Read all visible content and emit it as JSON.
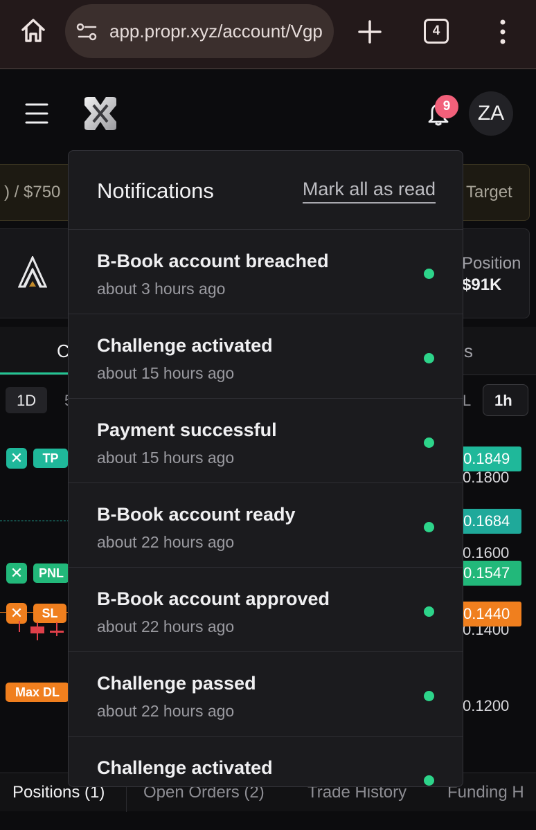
{
  "browser": {
    "url": "app.propr.xyz/account/Vgp",
    "tab_count": "4"
  },
  "header": {
    "notification_count": "9",
    "avatar_initials": "ZA"
  },
  "background": {
    "balance_fragment": ") / $750",
    "target_label": "Target",
    "position_label": "Position",
    "position_value": "$91K",
    "tab_left_fragment": "C",
    "tab_right_fragment": "s",
    "timeframe_left": "1D",
    "timeframe_left2": "5",
    "timeframe_right_fragment": "L",
    "timeframe_selected": "1h",
    "chart_chips": {
      "tp": "TP",
      "pnl": "PNL",
      "sl": "SL",
      "max_dl": "Max DL"
    },
    "price_tags": [
      "0.1849",
      "0.1684",
      "0.1547",
      "0.1440"
    ],
    "axis_values": [
      "0.1800",
      "0.1600",
      "0.1400",
      "0.1200"
    ],
    "colors": {
      "tp": "#1fb89a",
      "pnl": "#22b87a",
      "sl": "#f07f1e",
      "max_dl": "#f07f1e",
      "price_1684": "#1fa99a"
    }
  },
  "notifications": {
    "title": "Notifications",
    "mark_all_label": "Mark all as read",
    "items": [
      {
        "title": "B-Book account breached",
        "time": "about 3 hours ago"
      },
      {
        "title": "Challenge activated",
        "time": "about 15 hours ago"
      },
      {
        "title": "Payment successful",
        "time": "about 15 hours ago"
      },
      {
        "title": "B-Book account ready",
        "time": "about 22 hours ago"
      },
      {
        "title": "B-Book account approved",
        "time": "about 22 hours ago"
      },
      {
        "title": "Challenge passed",
        "time": "about 22 hours ago"
      },
      {
        "title": "Challenge activated",
        "time": ""
      }
    ]
  },
  "bottom_tabs": {
    "positions": "Positions (1)",
    "open_orders": "Open Orders (2)",
    "trade_history": "Trade History",
    "funding": "Funding H"
  }
}
